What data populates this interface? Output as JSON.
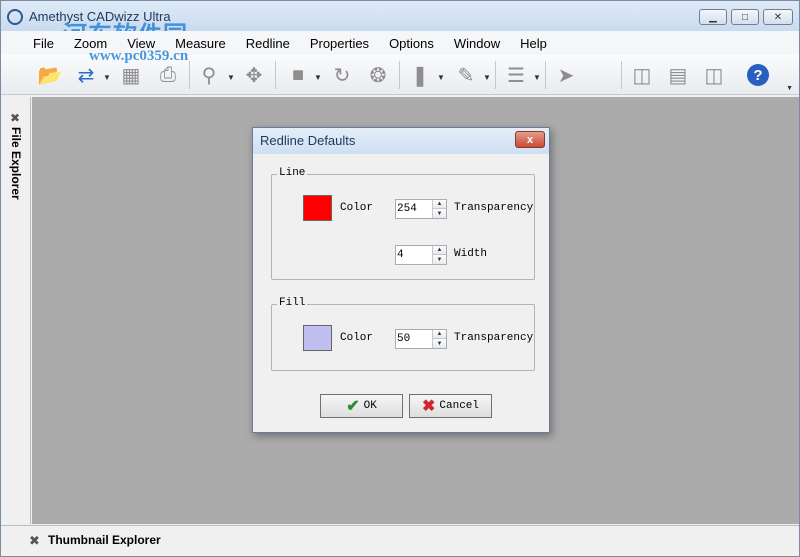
{
  "window": {
    "title": "Amethyst CADwizz Ultra",
    "watermark": "河东软件园",
    "watermark_url": "www.pc0359.cn",
    "minimize_glyph": "▁",
    "maximize_glyph": "□",
    "close_glyph": "✕"
  },
  "menu": {
    "items": [
      "File",
      "Zoom",
      "View",
      "Measure",
      "Redline",
      "Properties",
      "Options",
      "Window",
      "Help"
    ]
  },
  "toolbar": {
    "icons": [
      "open-folder-icon",
      "sync-arrows-icon",
      "save-disk-icon",
      "print-icon",
      "zoom-icon",
      "pan-icon",
      "cube-icon",
      "rotate-icon",
      "orbit-icon",
      "measure-icon",
      "pen-icon",
      "layers-icon",
      "pointer-icon",
      "window-cascade-icon",
      "window-tile-h-icon",
      "window-tile-v-icon",
      "help-icon"
    ],
    "help_label": "?"
  },
  "side_panel": {
    "label": "File Explorer"
  },
  "bottom_panel": {
    "label": "Thumbnail Explorer"
  },
  "dialog": {
    "title": "Redline Defaults",
    "close_label": "x",
    "line": {
      "legend": "Line",
      "color_label": "Color",
      "color": "#ff0000",
      "transparency_value": "254",
      "transparency_label": "Transparency",
      "width_value": "4",
      "width_label": "Width"
    },
    "fill": {
      "legend": "Fill",
      "color_label": "Color",
      "color": "#c0c0f0",
      "transparency_value": "50",
      "transparency_label": "Transparency"
    },
    "ok_label": "OK",
    "cancel_label": "Cancel"
  },
  "colors": {
    "canvas": "#ababab",
    "accent": "#2a6cc8"
  }
}
